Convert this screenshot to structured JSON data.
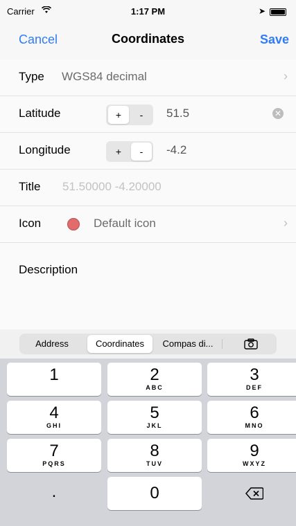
{
  "status": {
    "carrier": "Carrier",
    "time": "1:17 PM"
  },
  "nav": {
    "cancel": "Cancel",
    "title": "Coordinates",
    "save": "Save"
  },
  "form": {
    "type": {
      "label": "Type",
      "value": "WGS84 decimal"
    },
    "latitude": {
      "label": "Latitude",
      "plus": "+",
      "minus": "-",
      "value": "51.5"
    },
    "longitude": {
      "label": "Longitude",
      "plus": "+",
      "minus": "-",
      "value": "-4.2"
    },
    "title": {
      "label": "Title",
      "placeholder": "51.50000 -4.20000"
    },
    "icon": {
      "label": "Icon",
      "value": "Default icon",
      "color": "#e26c6c"
    },
    "description": {
      "label": "Description"
    }
  },
  "segments": {
    "items": [
      "Address",
      "Coordinates",
      "Compas di..."
    ],
    "selected": "Coordinates"
  },
  "keyboard": {
    "keys": [
      {
        "n": "1",
        "l": ""
      },
      {
        "n": "2",
        "l": "ABC"
      },
      {
        "n": "3",
        "l": "DEF"
      },
      {
        "n": "4",
        "l": "GHI"
      },
      {
        "n": "5",
        "l": "JKL"
      },
      {
        "n": "6",
        "l": "MNO"
      },
      {
        "n": "7",
        "l": "PQRS"
      },
      {
        "n": "8",
        "l": "TUV"
      },
      {
        "n": "9",
        "l": "WXYZ"
      },
      {
        "n": ".",
        "l": ""
      },
      {
        "n": "0",
        "l": ""
      }
    ]
  },
  "colors": {
    "accent": "#2f7cf6"
  }
}
